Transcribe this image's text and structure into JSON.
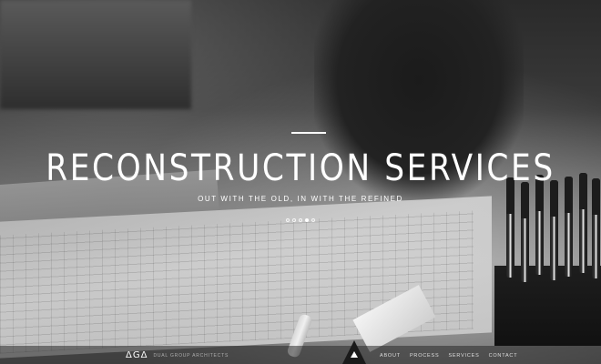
{
  "hero": {
    "title": "RECONSTRUCTION SERVICES",
    "subtitle": "OUT WITH THE OLD, IN WITH THE REFINED"
  },
  "slider": {
    "dot_count": 5,
    "active_index": 3
  },
  "brand": {
    "logo": "ΔGΔ",
    "name": "DUAL GROUP ARCHITECTS"
  },
  "nav": {
    "items": [
      {
        "label": "ABOUT"
      },
      {
        "label": "PROCESS"
      },
      {
        "label": "SERVICES"
      },
      {
        "label": "CONTACT"
      }
    ]
  },
  "colors": {
    "text": "#ffffff",
    "navbar": "#282828",
    "accent": "#1a1a1a"
  }
}
